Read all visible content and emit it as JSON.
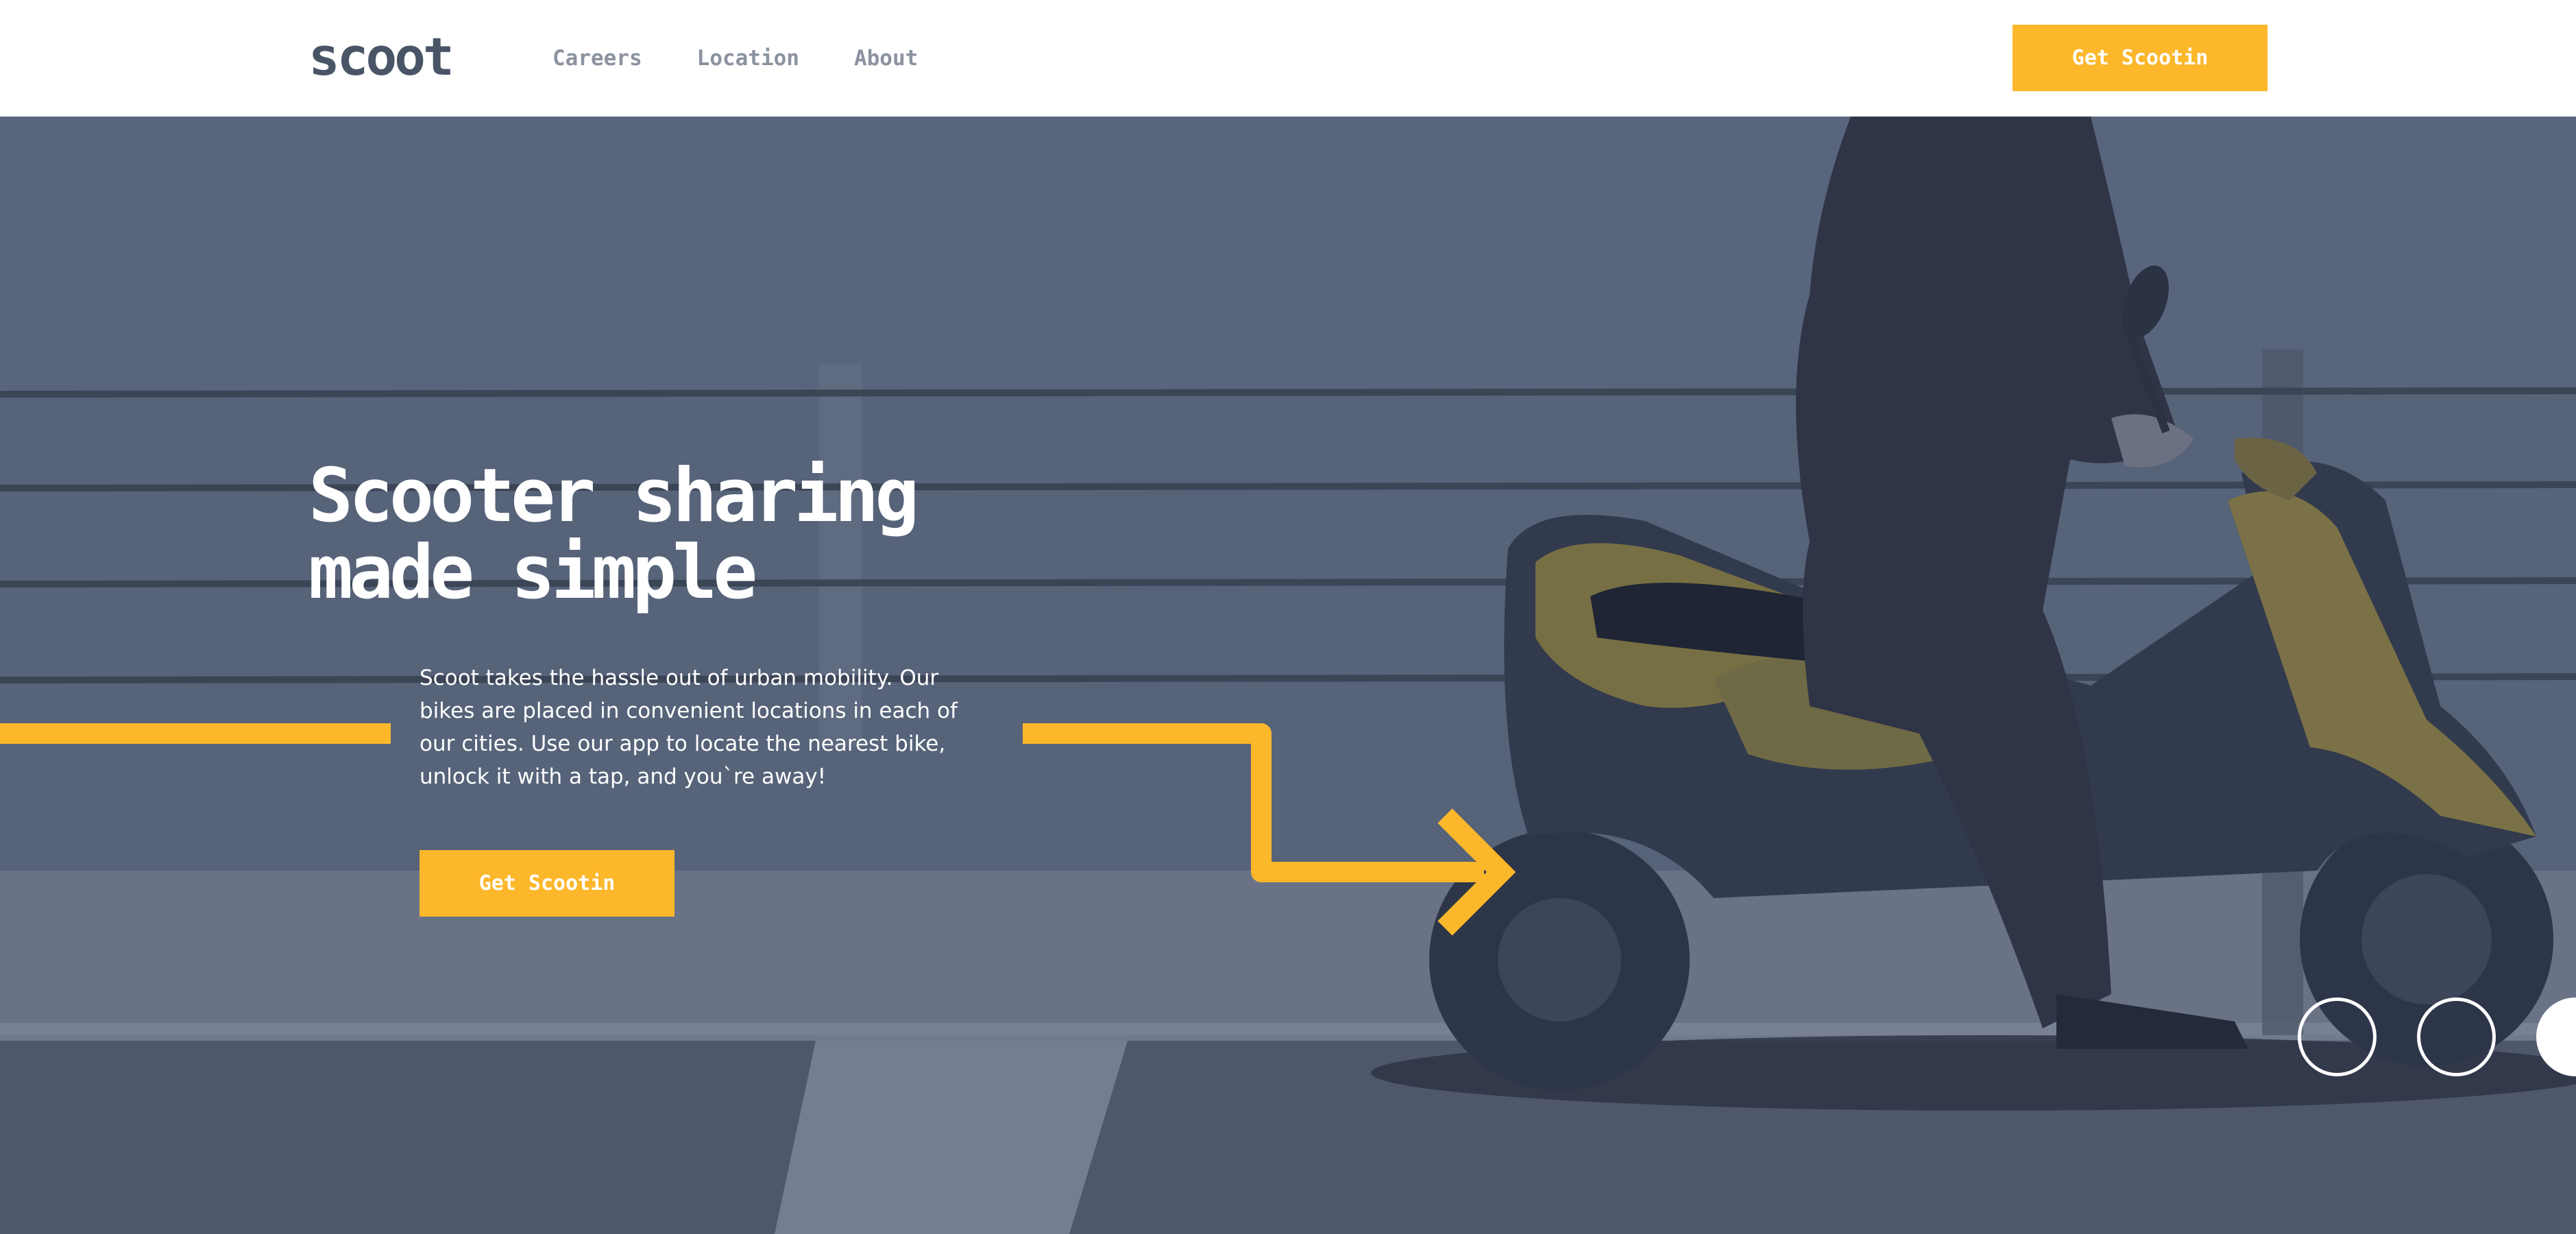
{
  "header": {
    "logo": "scoot",
    "nav": [
      {
        "label": "Careers"
      },
      {
        "label": "Location"
      },
      {
        "label": "About"
      }
    ],
    "cta_label": "Get Scootin"
  },
  "hero": {
    "headline_line1": "Scooter sharing",
    "headline_line2": "made simple",
    "description": "Scoot takes the hassle out of urban mobility. Our bikes are placed in convenient locations in each of our cities. Use our app to locate the nearest bike, unlock it with a tap, and you`re away!",
    "cta_label": "Get Scootin",
    "slider": {
      "count": 3,
      "active_index": 2
    }
  },
  "colors": {
    "accent": "#fcb72b",
    "dark_blue": "#495567",
    "nav_gray": "#8b92a0",
    "white": "#ffffff"
  }
}
